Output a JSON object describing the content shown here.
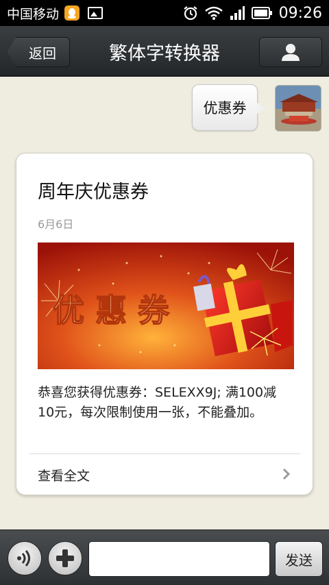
{
  "status_bar": {
    "carrier": "中国移动",
    "time": "09:26",
    "icons": [
      "qq-notification-icon",
      "image-notification-icon",
      "alarm-icon",
      "wifi-icon",
      "signal-icon",
      "battery-icon"
    ]
  },
  "header": {
    "back_label": "返回",
    "title": "繁体字转换器",
    "profile_icon": "person-icon"
  },
  "conversation": {
    "sent_message": "优惠券",
    "avatar": "forbidden-city-photo"
  },
  "card": {
    "title": "周年庆优惠券",
    "date": "6月6日",
    "image_text": "优 惠 券",
    "description": "恭喜您获得优惠券：SELEXX9J; 满100减10元，每次限制使用一张，不能叠加。",
    "read_more": "查看全文"
  },
  "input_bar": {
    "voice_icon": "voice-icon",
    "plus_icon": "plus-icon",
    "input_value": "",
    "send_label": "发送"
  },
  "colors": {
    "background": "#efece0",
    "header": "#2c2f31",
    "coupon_red": "#c42a0e",
    "coupon_orange": "#f08a1c"
  }
}
